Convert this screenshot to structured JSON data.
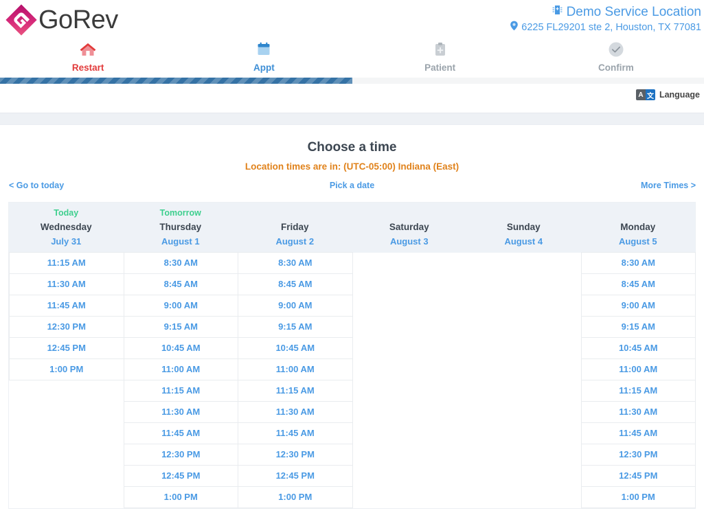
{
  "brand": {
    "name": "GoRev",
    "logo_icon": "gorev-diamond-logo"
  },
  "location": {
    "name": "Demo Service Location",
    "address": "6225 FL29201 ste 2, Houston, TX 77081",
    "building_icon": "hospital-icon",
    "pin_icon": "map-pin-icon"
  },
  "steps": [
    {
      "key": "restart",
      "label": "Restart",
      "icon": "home-icon",
      "state": "restart"
    },
    {
      "key": "appt",
      "label": "Appt",
      "icon": "calendar-icon",
      "state": "active"
    },
    {
      "key": "patient",
      "label": "Patient",
      "icon": "clipboard-plus-icon",
      "state": "inactive"
    },
    {
      "key": "confirm",
      "label": "Confirm",
      "icon": "check-circle-icon",
      "state": "inactive"
    }
  ],
  "progress": {
    "percent": 50
  },
  "language": {
    "label": "Language",
    "icon": "translate-icon",
    "a_glyph": "A",
    "cjk_glyph": "文"
  },
  "title": {
    "heading": "Choose a time",
    "timezone_note": "Location times are in: (UTC-05:00) Indiana (East)"
  },
  "nav": {
    "go_to_today": "< Go to today",
    "pick_a_date": "Pick a date",
    "more_times": "More Times >"
  },
  "colors": {
    "accent_blue": "#4a9ae4",
    "green": "#3ecf8e",
    "orange": "#e0821b",
    "red": "#e23b3b",
    "progress_blue": "#3572a5",
    "header_band": "#eef2f7"
  },
  "calendar": {
    "columns": [
      {
        "relative": "Today",
        "day": "Wednesday",
        "date": "July 31",
        "slots": [
          "11:15 AM",
          "11:30 AM",
          "11:45 AM",
          "12:30 PM",
          "12:45 PM",
          "1:00 PM"
        ]
      },
      {
        "relative": "Tomorrow",
        "day": "Thursday",
        "date": "August 1",
        "slots": [
          "8:30 AM",
          "8:45 AM",
          "9:00 AM",
          "9:15 AM",
          "10:45 AM",
          "11:00 AM",
          "11:15 AM",
          "11:30 AM",
          "11:45 AM",
          "12:30 PM",
          "12:45 PM",
          "1:00 PM"
        ]
      },
      {
        "relative": "",
        "day": "Friday",
        "date": "August 2",
        "slots": [
          "8:30 AM",
          "8:45 AM",
          "9:00 AM",
          "9:15 AM",
          "10:45 AM",
          "11:00 AM",
          "11:15 AM",
          "11:30 AM",
          "11:45 AM",
          "12:30 PM",
          "12:45 PM",
          "1:00 PM"
        ]
      },
      {
        "relative": "",
        "day": "Saturday",
        "date": "August 3",
        "slots": []
      },
      {
        "relative": "",
        "day": "Sunday",
        "date": "August 4",
        "slots": []
      },
      {
        "relative": "",
        "day": "Monday",
        "date": "August 5",
        "slots": [
          "8:30 AM",
          "8:45 AM",
          "9:00 AM",
          "9:15 AM",
          "10:45 AM",
          "11:00 AM",
          "11:15 AM",
          "11:30 AM",
          "11:45 AM",
          "12:30 PM",
          "12:45 PM",
          "1:00 PM"
        ]
      }
    ]
  }
}
